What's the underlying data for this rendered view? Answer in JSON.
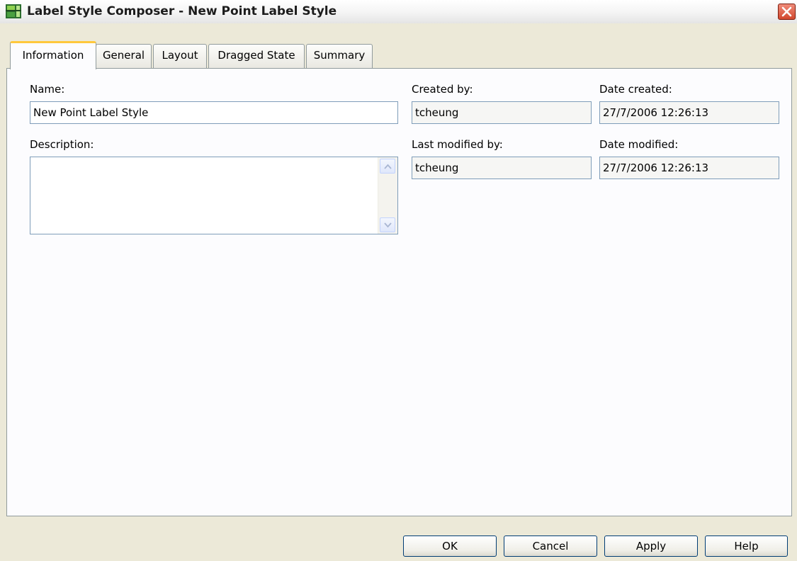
{
  "window": {
    "title": "Label Style Composer - New Point Label Style",
    "icon": "label-style-app-icon",
    "close_icon": "close-x-icon"
  },
  "tabs": [
    {
      "label": "Information",
      "active": true
    },
    {
      "label": "General",
      "active": false
    },
    {
      "label": "Layout",
      "active": false
    },
    {
      "label": "Dragged State",
      "active": false
    },
    {
      "label": "Summary",
      "active": false
    }
  ],
  "info": {
    "name_label": "Name:",
    "name_value": "New Point Label Style",
    "description_label": "Description:",
    "description_value": "",
    "created_by_label": "Created by:",
    "created_by_value": "tcheung",
    "date_created_label": "Date created:",
    "date_created_value": "27/7/2006 12:26:13",
    "last_modified_by_label": "Last modified by:",
    "last_modified_by_value": "tcheung",
    "date_modified_label": "Date modified:",
    "date_modified_value": "27/7/2006 12:26:13"
  },
  "buttons": {
    "ok": "OK",
    "cancel": "Cancel",
    "apply": "Apply",
    "help": "Help"
  },
  "colors": {
    "dialog_background": "#ece9d8",
    "active_tab_accent": "#ffc83c",
    "field_border": "#7f9db9",
    "close_button": "#d2482e"
  }
}
